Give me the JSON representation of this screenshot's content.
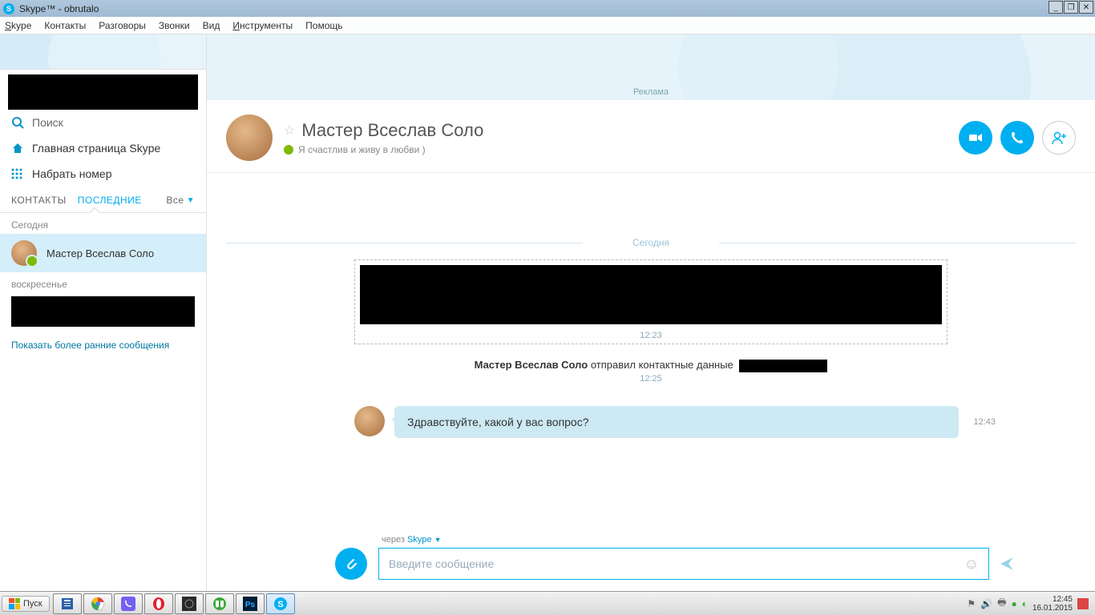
{
  "window": {
    "title": "Skype™ - obrutalo"
  },
  "menu": {
    "skype": "Skype",
    "contacts": "Контакты",
    "conversations": "Разговоры",
    "calls": "Звонки",
    "view": "Вид",
    "tools": "Инструменты",
    "help": "Помощь"
  },
  "sidebar": {
    "search": "Поиск",
    "home": "Главная страница Skype",
    "dial": "Набрать номер",
    "tab_contacts": "КОНТАКТЫ",
    "tab_recent": "ПОСЛЕДНИЕ",
    "filter_all": "Все",
    "section_today": "Сегодня",
    "contact1": "Мастер Всеслав Соло",
    "section_sunday": "воскресенье",
    "show_older": "Показать более ранние сообщения"
  },
  "ad": {
    "label": "Реклама"
  },
  "chat": {
    "title": "Мастер Всеслав Соло",
    "status_text": "Я счастлив и живу в любви )",
    "day_label": "Сегодня",
    "sys_time1": "12:23",
    "sys_sender": "Мастер Всеслав Соло",
    "sys_action": " отправил контактные данные",
    "sys_time2": "12:25",
    "msg1": "Здравствуйте, какой у вас вопрос?",
    "msg1_time": "12:43",
    "via_prefix": "через ",
    "via_skype": "Skype",
    "compose_placeholder": "Введите сообщение"
  },
  "taskbar": {
    "start": "Пуск",
    "clock_time": "12:45",
    "clock_date": "16.01.2015"
  }
}
